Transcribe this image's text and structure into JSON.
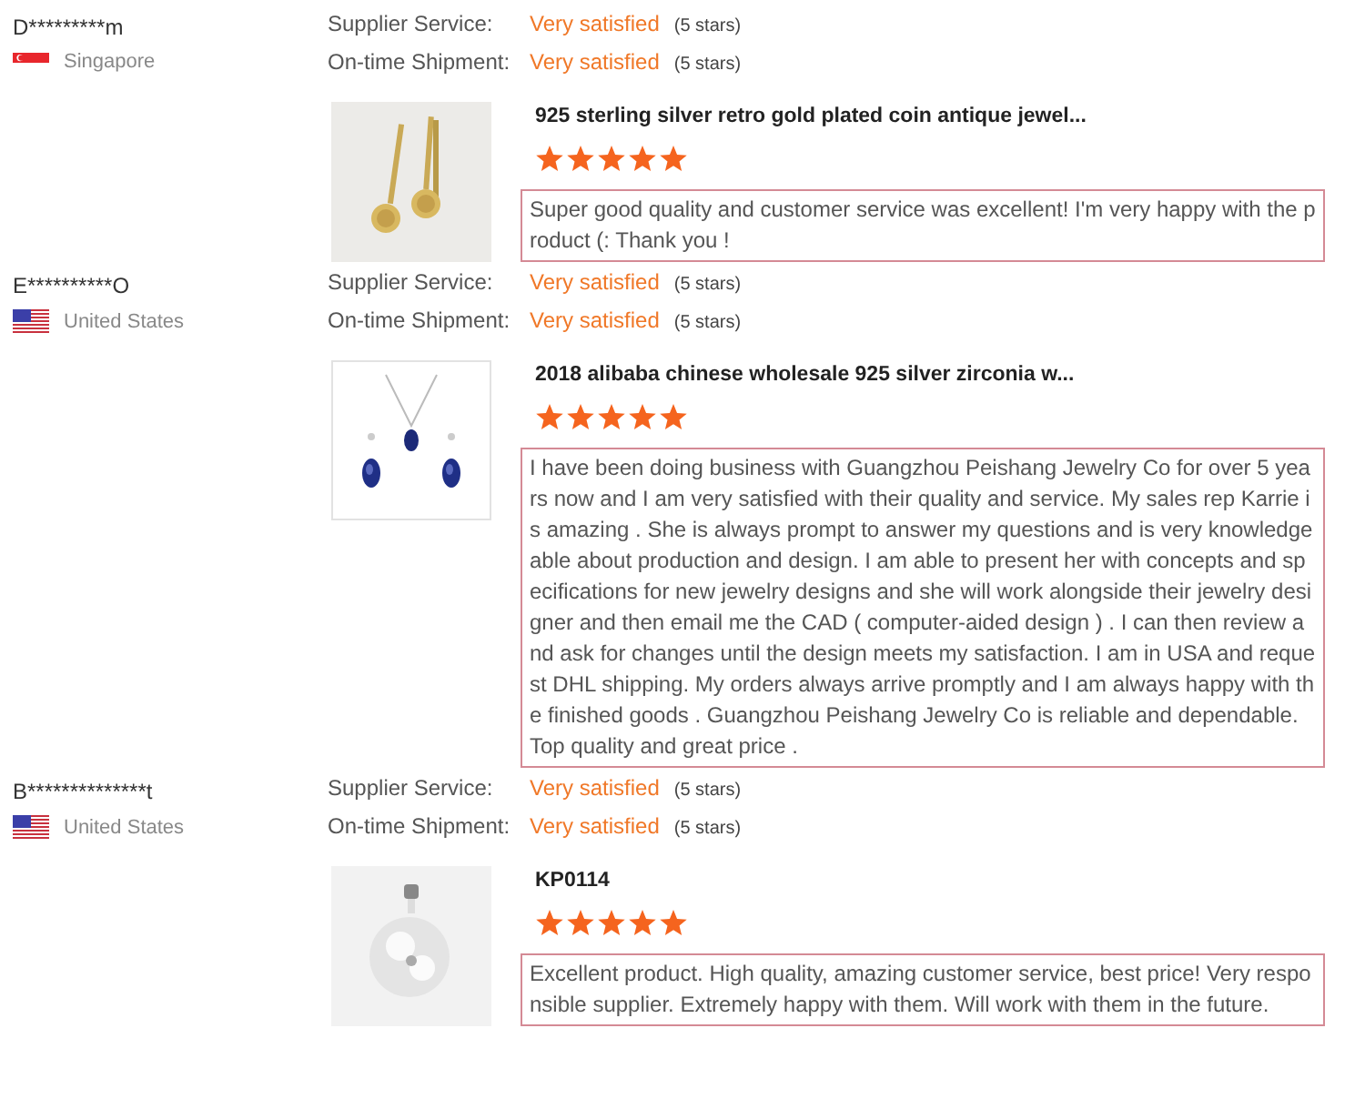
{
  "reviews": [
    {
      "reviewer": {
        "name": "D*********m",
        "country": "Singapore",
        "flag": {
          "kind": "sg"
        }
      },
      "ratings": [
        {
          "label": "Supplier Service:",
          "value": "Very satisfied",
          "stars_text": "(5 stars)"
        },
        {
          "label": "On-time Shipment:",
          "value": "Very satisfied",
          "stars_text": "(5 stars)"
        }
      ],
      "product": {
        "kind": "earrings",
        "title": "925 sterling silver retro gold plated coin antique jewel...",
        "stars": 5
      },
      "comment": "Super good quality and customer service was excellent! I'm very happy with the product (: Thank you !"
    },
    {
      "reviewer": {
        "name": "E**********O",
        "country": "United States",
        "flag": {
          "kind": "us"
        }
      },
      "ratings": [
        {
          "label": "Supplier Service:",
          "value": "Very satisfied",
          "stars_text": "(5 stars)"
        },
        {
          "label": "On-time Shipment:",
          "value": "Very satisfied",
          "stars_text": "(5 stars)"
        }
      ],
      "product": {
        "kind": "necklace",
        "title": "2018 alibaba chinese wholesale 925 silver zirconia w...",
        "stars": 5
      },
      "comment": "I have been doing business with Guangzhou Peishang Jewelry Co for over 5 years now and I am very satisfied with their quality and service.  My sales rep Karrie is amazing . She is always prompt to answer my questions and is very knowledgeable about production and design. I am able to present her with concepts and specifications for new jewelry designs and she will work alongside their jewelry designer and then email me the CAD ( computer-aided design ) . I can then review and ask for changes until the design meets my satisfaction. I am in USA and request DHL shipping. My orders always arrive promptly and I am always happy with the finished goods . Guangzhou Peishang Jewelry Co is reliable and dependable. Top quality and great price ."
    },
    {
      "reviewer": {
        "name": "B**************t",
        "country": "United States",
        "flag": {
          "kind": "us"
        }
      },
      "ratings": [
        {
          "label": "Supplier Service:",
          "value": "Very satisfied",
          "stars_text": "(5 stars)"
        },
        {
          "label": "On-time Shipment:",
          "value": "Very satisfied",
          "stars_text": "(5 stars)"
        }
      ],
      "product": {
        "kind": "pendant",
        "title": "KP0114",
        "stars": 5
      },
      "comment": "Excellent product. High quality, amazing customer service, best price! Very responsible supplier. Extremely happy with them. Will work with them in the future."
    }
  ]
}
